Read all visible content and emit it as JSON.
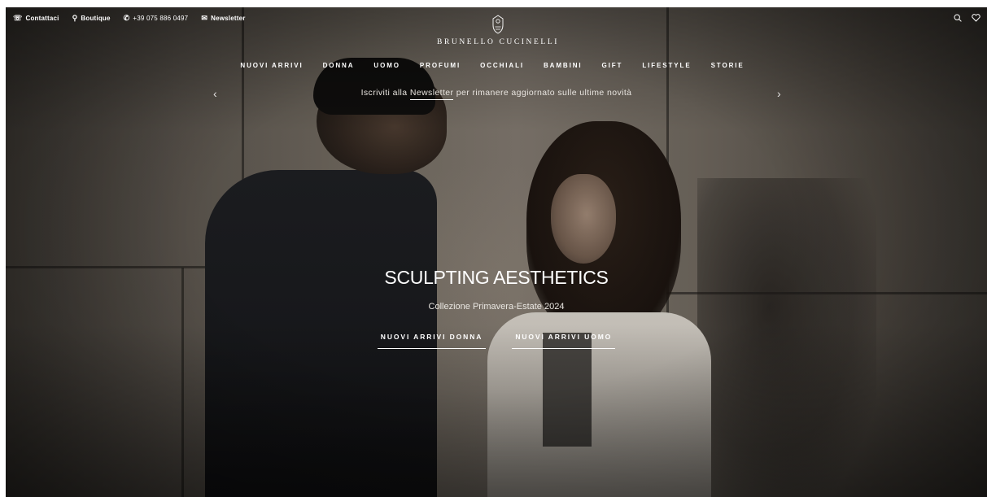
{
  "utility_bar": {
    "contact": {
      "label": "Contattaci",
      "icon": "headset-icon"
    },
    "boutique": {
      "label": "Boutique",
      "icon": "location-pin-icon"
    },
    "phone": {
      "label": "+39 075 886 0497",
      "icon": "phone-icon"
    },
    "newsletter": {
      "label": "Newsletter",
      "icon": "mail-icon"
    }
  },
  "header_icons": [
    "search-icon",
    "heart-icon"
  ],
  "logo": {
    "text": "BRUNELLO CUCINELLI"
  },
  "nav": {
    "items": [
      "NUOVI ARRIVI",
      "DONNA",
      "UOMO",
      "PROFUMI",
      "OCCHIALI",
      "BAMBINI",
      "GIFT",
      "LIFESTYLE",
      "STORIE"
    ]
  },
  "banner": {
    "before": "Iscriviti alla ",
    "link": "Newsletter",
    "after": " per rimanere aggiornato sulle ultime novità"
  },
  "hero": {
    "title": "SCULPTING AESTHETICS",
    "subtitle": "Collezione Primavera-Estate 2024",
    "cta_women": "NUOVI ARRIVI DONNA",
    "cta_men": "NUOVI ARRIVI UOMO"
  },
  "colors": {
    "text": "#ffffff",
    "background": "#6f685e"
  }
}
